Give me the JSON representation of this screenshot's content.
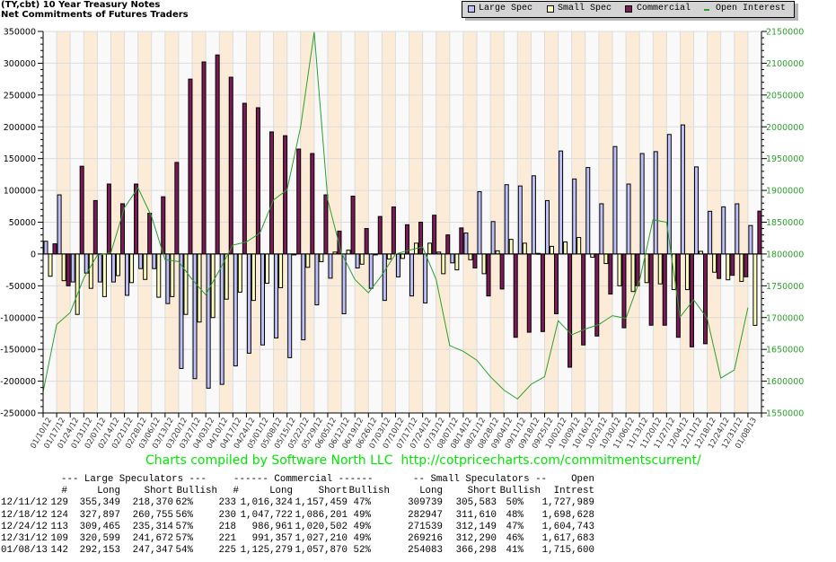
{
  "title": {
    "line1": "(TY,cbt) 10 Year Treasury Notes",
    "line2": "Net Commitments of Futures Traders"
  },
  "legend": {
    "large": "Large Spec",
    "small": "Small Spec",
    "commercial": "Commercial",
    "oi": "Open Interest"
  },
  "colors": {
    "large": "#c0c0f8",
    "small": "#ffffc0",
    "commercial": "#7b1a57",
    "oi": "#2ca02c",
    "band_a": "#f9f9f9",
    "band_b": "#fcebd7",
    "right_axis": "#2ca02c"
  },
  "credit": "Charts compiled by Software North LLC  http://cotpricecharts.com/commitmentscurrent/",
  "chart_data": {
    "type": "bar",
    "title": "(TY,cbt) 10 Year Treasury Notes - Net Commitments of Futures Traders",
    "categories": [
      "01/10/12",
      "01/17/12",
      "01/24/12",
      "01/31/12",
      "02/07/12",
      "02/14/12",
      "02/21/12",
      "02/28/12",
      "03/06/12",
      "03/13/12",
      "03/20/12",
      "03/27/12",
      "04/03/12",
      "04/10/12",
      "04/17/12",
      "04/24/12",
      "05/01/12",
      "05/08/12",
      "05/15/12",
      "05/22/12",
      "05/29/12",
      "06/05/12",
      "06/12/12",
      "06/19/12",
      "06/26/12",
      "07/03/12",
      "07/10/12",
      "07/17/12",
      "07/24/12",
      "07/31/12",
      "08/07/12",
      "08/14/12",
      "08/21/12",
      "08/28/12",
      "09/04/12",
      "09/11/12",
      "09/18/12",
      "09/25/12",
      "10/02/12",
      "10/09/12",
      "10/16/12",
      "10/23/12",
      "10/30/12",
      "11/06/12",
      "11/13/12",
      "11/20/12",
      "11/27/12",
      "12/04/12",
      "12/11/12",
      "12/18/12",
      "12/24/12",
      "12/31/12",
      "01/08/13"
    ],
    "series": [
      {
        "name": "Large Spec",
        "axis": "left",
        "type": "bar",
        "values": [
          20000,
          93000,
          -44000,
          -30000,
          -44000,
          -44000,
          -65000,
          -23000,
          -23000,
          -78000,
          -180000,
          -196000,
          -211000,
          -205000,
          -176000,
          -156000,
          -143000,
          -132000,
          -163000,
          -135000,
          -80000,
          -38000,
          -94000,
          -22000,
          -54000,
          -73000,
          -36000,
          -66000,
          -77000,
          3000,
          -14000,
          33000,
          98000,
          51000,
          109000,
          107000,
          123000,
          84000,
          162000,
          118000,
          136000,
          79000,
          169000,
          110000,
          158000,
          161000,
          188000,
          203000,
          136979,
          67142,
          74151,
          78927,
          44806
        ]
      },
      {
        "name": "Small Spec",
        "axis": "left",
        "type": "bar",
        "values": [
          -35000,
          -42000,
          -95000,
          -54000,
          -67000,
          -34000,
          -45000,
          -40000,
          -68000,
          -67000,
          -95000,
          -107000,
          -100000,
          -71000,
          -60000,
          -73000,
          -46000,
          -53000,
          -1000,
          -21000,
          -12000,
          3000,
          6000,
          -16000,
          -1000,
          -8000,
          -7000,
          17000,
          17000,
          -31000,
          -25000,
          -9000,
          -31000,
          5000,
          23000,
          17000,
          1000,
          12000,
          19000,
          26000,
          -5000,
          -15000,
          -50000,
          -59000,
          -45000,
          -47000,
          -56000,
          -56000,
          4156,
          -28663,
          -40610,
          -43074,
          -112215
        ]
      },
      {
        "name": "Commercial",
        "axis": "left",
        "type": "bar",
        "values": [
          16000,
          -50000,
          138000,
          84000,
          110000,
          79000,
          110000,
          64000,
          90000,
          144000,
          275000,
          302000,
          313000,
          278000,
          237000,
          230000,
          192000,
          186000,
          165000,
          158000,
          93000,
          36000,
          91000,
          40000,
          59000,
          74000,
          46000,
          50000,
          61000,
          30000,
          41000,
          -22000,
          -66000,
          -55000,
          -131000,
          -123000,
          -122000,
          -94000,
          -178000,
          -143000,
          -129000,
          -63000,
          -116000,
          -50000,
          -112000,
          -112000,
          -131000,
          -146000,
          -141135,
          -38479,
          -33541,
          -35853,
          67409
        ]
      },
      {
        "name": "Open Interest",
        "axis": "right",
        "type": "line",
        "values": [
          1583000,
          1689000,
          1708000,
          1762000,
          1798000,
          1802000,
          1873000,
          1904000,
          1859000,
          1791000,
          1788000,
          1760000,
          1736000,
          1774000,
          1814000,
          1819000,
          1833000,
          1885000,
          1901000,
          2000000,
          2149000,
          1885000,
          1802000,
          1760000,
          1739000,
          1767000,
          1800000,
          1806000,
          1811000,
          1760000,
          1656000,
          1647000,
          1633000,
          1607000,
          1586000,
          1572000,
          1595000,
          1607000,
          1695000,
          1673000,
          1682000,
          1689000,
          1703000,
          1699000,
          1758000,
          1854000,
          1850000,
          1701000,
          1727989,
          1698628,
          1604743,
          1617683,
          1715600
        ]
      }
    ],
    "ylim_left": [
      -250000,
      350000
    ],
    "ylim_right": [
      1550000,
      2150000
    ],
    "left_ticks": [
      "350000",
      "300000",
      "250000",
      "200000",
      "150000",
      "100000",
      "50000",
      "0",
      "-50000",
      "-100000",
      "-150000",
      "-200000",
      "-250000"
    ],
    "right_ticks": [
      "2150000",
      "2100000",
      "2050000",
      "2000000",
      "1950000",
      "1900000",
      "1850000",
      "1800000",
      "1750000",
      "1700000",
      "1650000",
      "1600000",
      "1550000"
    ],
    "grid": true,
    "legend_position": "top-right"
  },
  "table": {
    "group_headers": {
      "large": "--- Large Speculators ---",
      "commercial": "------ Commercial ------",
      "small": "-- Small Speculators --",
      "oi": "Open"
    },
    "col_headers": {
      "l_num": "#",
      "l_long": "Long",
      "l_short": "Short",
      "l_bull": "Bullish",
      "c_num": "#",
      "c_long": "Long",
      "c_short": "Short",
      "c_bull": "Bullish",
      "s_long": "Long",
      "s_short": "Short",
      "s_bull": "Bullish",
      "oi": "Intrest"
    },
    "rows": [
      {
        "date": "12/11/12",
        "l_num": "129",
        "l_long": "355,349",
        "l_short": "218,370",
        "l_bull": "62%",
        "c_num": "233",
        "c_long": "1,016,324",
        "c_short": "1,157,459",
        "c_bull": "47%",
        "s_long": "309739",
        "s_short": "305,583",
        "s_bull": "50%",
        "oi": "1,727,989"
      },
      {
        "date": "12/18/12",
        "l_num": "124",
        "l_long": "327,897",
        "l_short": "260,755",
        "l_bull": "56%",
        "c_num": "230",
        "c_long": "1,047,722",
        "c_short": "1,086,201",
        "c_bull": "49%",
        "s_long": "282947",
        "s_short": "311,610",
        "s_bull": "48%",
        "oi": "1,698,628"
      },
      {
        "date": "12/24/12",
        "l_num": "113",
        "l_long": "309,465",
        "l_short": "235,314",
        "l_bull": "57%",
        "c_num": "218",
        "c_long": "986,961",
        "c_short": "1,020,502",
        "c_bull": "49%",
        "s_long": "271539",
        "s_short": "312,149",
        "s_bull": "47%",
        "oi": "1,604,743"
      },
      {
        "date": "12/31/12",
        "l_num": "109",
        "l_long": "320,599",
        "l_short": "241,672",
        "l_bull": "57%",
        "c_num": "221",
        "c_long": "991,357",
        "c_short": "1,027,210",
        "c_bull": "49%",
        "s_long": "269216",
        "s_short": "312,290",
        "s_bull": "46%",
        "oi": "1,617,683"
      },
      {
        "date": "01/08/13",
        "l_num": "142",
        "l_long": "292,153",
        "l_short": "247,347",
        "l_bull": "54%",
        "c_num": "225",
        "c_long": "1,125,279",
        "c_short": "1,057,870",
        "c_bull": "52%",
        "s_long": "254083",
        "s_short": "366,298",
        "s_bull": "41%",
        "oi": "1,715,600"
      }
    ]
  }
}
